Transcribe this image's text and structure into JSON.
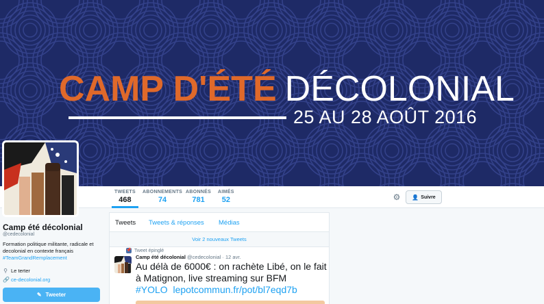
{
  "banner": {
    "title_orange": "CAMP D'ÉTÉ",
    "title_white": "DÉCOLONIAL",
    "dates": "25 AU 28 AOÛT 2016",
    "colors": {
      "background": "#1e2a66",
      "accent": "#e0692a"
    }
  },
  "stats": [
    {
      "label": "TWEETS",
      "value": "468"
    },
    {
      "label": "ABONNEMENTS",
      "value": "74"
    },
    {
      "label": "ABONNÉS",
      "value": "781"
    },
    {
      "label": "AIMÉS",
      "value": "52"
    }
  ],
  "actions": {
    "settings_icon": "gear-icon",
    "follow_label": "Suivre"
  },
  "profile": {
    "name": "Camp été décolonial",
    "handle": "@cedecolonial",
    "bio": "Formation politique militante, radicale et decolonial en contexte français",
    "hashtag": "#TeamGrandRemplacement",
    "location": "Le terter",
    "website": "ce-decolonial.org",
    "tweet_button": "Tweeter"
  },
  "timeline": {
    "tabs": [
      "Tweets",
      "Tweets & réponses",
      "Médias"
    ],
    "new_tweets": "Voir 2 nouveaux Tweets",
    "pinned_label": "Tweet épinglé",
    "tweet": {
      "name": "Camp été décolonial",
      "handle_date": "@cedecolonial · 12 avr.",
      "text": "Au délà de 6000€ : on rachète Libé, on le fait à Matignon, live streaming sur BFM",
      "hashtag": "#YOLO",
      "link": "lepotcommun.fr/pot/bl7eqd7b"
    }
  }
}
